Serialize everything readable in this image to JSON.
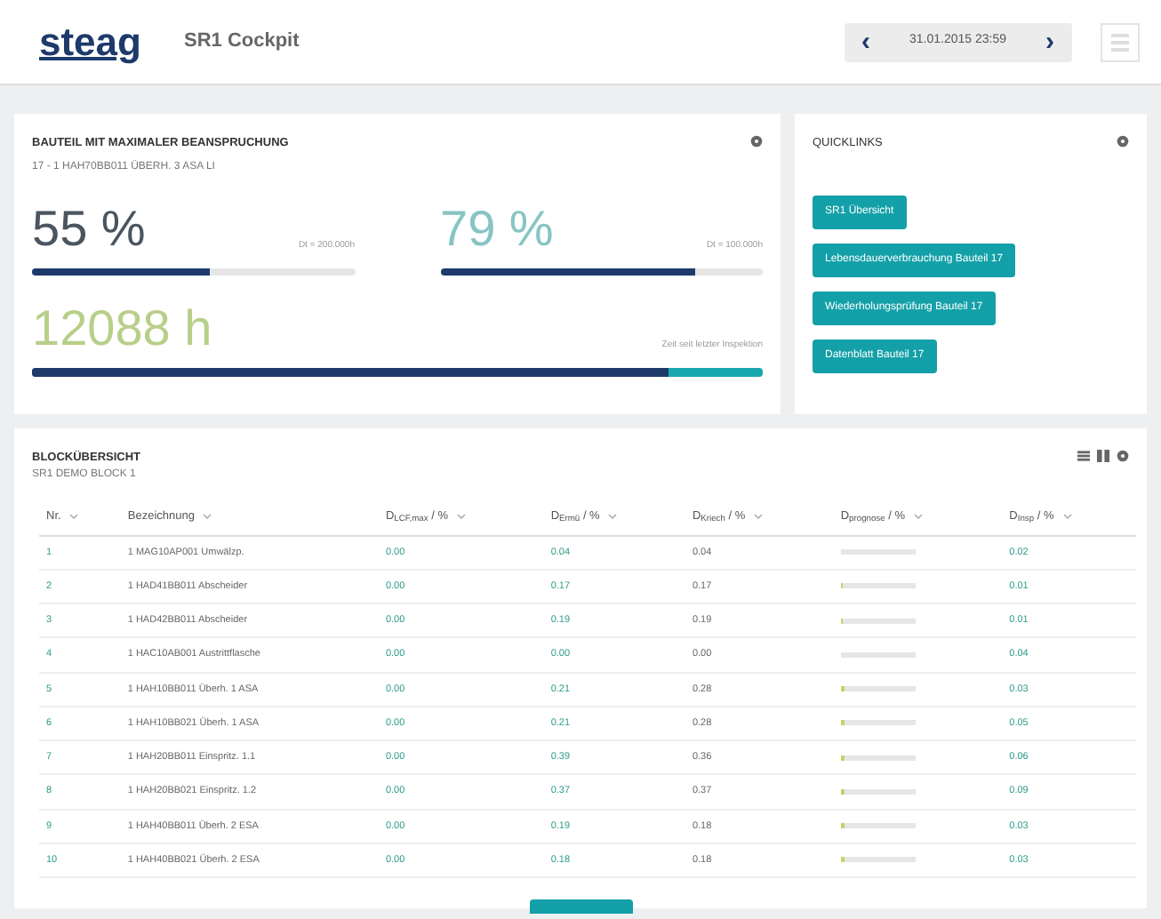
{
  "header": {
    "logo": "steag",
    "title": "SR1 Cockpit",
    "date": "31.01.2015 23:59",
    "prev": "‹",
    "next": "›"
  },
  "load_card": {
    "title": "BAUTEIL MIT MAXIMALER BEANSPRUCHUNG",
    "subtitle": "17 - 1 HAH70BB011 ÜBERH. 3 ASA LI",
    "metrics": [
      {
        "value": "55 %",
        "note": "Dt = 200.000h",
        "level": 0.55,
        "kind": "dark"
      },
      {
        "value": "79 %",
        "note": "Dt = 100.000h",
        "level": 0.79,
        "kind": "light"
      }
    ],
    "hours": {
      "value": "12088 h",
      "note": "Zeit seit letzter Inspektion",
      "level": 0.87
    }
  },
  "quicklinks": {
    "title": "QUICKLINKS",
    "links": [
      "SR1 Übersicht",
      "Lebensdauerverbrauchung Bauteil 17",
      "Wiederholungsprüfung Bauteil 17",
      "Datenblatt Bauteil 17"
    ]
  },
  "overview": {
    "title": "BLOCKÜBERSICHT",
    "subtitle": "SR1 DEMO BLOCK 1",
    "columns": [
      "Nr.",
      "Bezeichnung",
      "D$_{LCF,max}$ / %",
      "D$_{Ermü}$ / %",
      "D$_{Kriech}$ / %",
      "D$_{prognose}$ / %",
      "D$_{Insp}$ / %"
    ],
    "rows": [
      {
        "nr": "1",
        "name": "1 MAG10AP001 Umwälzp.",
        "c3": "0.00",
        "c4": "0.04",
        "c5": "0.04",
        "c7": "0.02"
      },
      {
        "nr": "2",
        "name": "1 HAD41BB011 Abscheider",
        "c3": "0.00",
        "c4": "0.17",
        "c5": "0.17",
        "level": 0.03,
        "c7": "0.01"
      },
      {
        "nr": "3",
        "name": "1 HAD42BB011 Abscheider",
        "c3": "0.00",
        "c4": "0.19",
        "c5": "0.19",
        "level": 0.03,
        "c7": "0.01"
      },
      {
        "nr": "4",
        "name": "1 HAC10AB001 Austrittflasche",
        "c3": "0.00",
        "c4": "0.00",
        "c5": "0.00",
        "c7": "0.04"
      },
      {
        "nr": "5",
        "name": "1 HAH10BB011 Überh. 1 ASA",
        "c3": "0.00",
        "c4": "0.21",
        "c5": "0.28",
        "level": 0.04,
        "c7": "0.03"
      },
      {
        "nr": "6",
        "name": "1 HAH10BB021 Überh. 1 ASA",
        "c3": "0.00",
        "c4": "0.21",
        "c5": "0.28",
        "level": 0.04,
        "c7": "0.05"
      },
      {
        "nr": "7",
        "name": "1 HAH20BB011 Einspritz. 1.1",
        "c3": "0.00",
        "c4": "0.39",
        "c5": "0.36",
        "level": 0.05,
        "c7": "0.06"
      },
      {
        "nr": "8",
        "name": "1 HAH20BB021 Einspritz. 1.2",
        "c3": "0.00",
        "c4": "0.37",
        "c5": "0.37",
        "level": 0.05,
        "c7": "0.09"
      },
      {
        "nr": "9",
        "name": "1 HAH40BB011 Überh. 2 ESA",
        "c3": "0.00",
        "c4": "0.19",
        "c5": "0.18",
        "level": 0.04,
        "c7": "0.03"
      },
      {
        "nr": "10",
        "name": "1 HAH40BB021 Überh. 2 ESA",
        "c3": "0.00",
        "c4": "0.18",
        "c5": "0.18",
        "level": 0.04,
        "c7": "0.03"
      }
    ]
  }
}
